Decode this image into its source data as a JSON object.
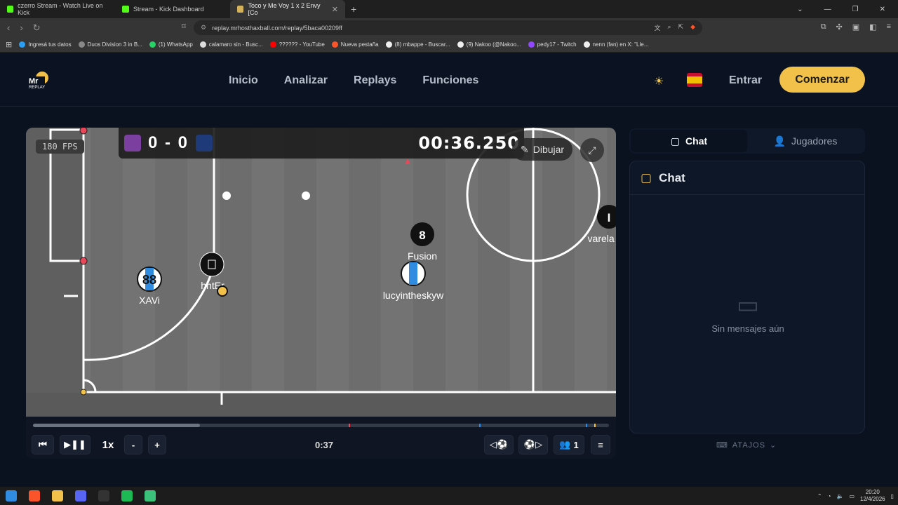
{
  "browser": {
    "tabs": [
      {
        "label": "czerro Stream - Watch Live on Kick",
        "color": "#53fc18"
      },
      {
        "label": "Stream - Kick Dashboard",
        "color": "#53fc18"
      },
      {
        "label": "Toco y Me Voy 1 x 2 Envy [Co",
        "color": "#d4b25a"
      }
    ],
    "url": "replay.mrhosthaxball.com/replay/5baca00209ff",
    "bookmarks": [
      "Ingresá tus datos",
      "Duos Division 3 in B...",
      "(1) WhatsApp",
      "calamaro sin - Busc...",
      "?????? - YouTube",
      "Nueva pestaña",
      "(8) mbappe - Buscar...",
      "(9) Nakoo (@Nakoo...",
      "pedy17 - Twitch",
      "nenn (fan) en X: \"Lle..."
    ]
  },
  "header": {
    "logo_text": "Mr REPLAY",
    "nav": [
      "Inicio",
      "Analizar",
      "Replays",
      "Funciones"
    ],
    "login": "Entrar",
    "cta": "Comenzar"
  },
  "replay": {
    "fps": "180 FPS",
    "score": "0 - 0",
    "clock": "00:36.250",
    "draw_label": "Dibujar",
    "players": [
      {
        "name": "XAVi",
        "number": "88",
        "team": "blue"
      },
      {
        "name": "hntEr",
        "number": "",
        "team": "black"
      },
      {
        "name": "Fusion",
        "number": "8",
        "team": "black"
      },
      {
        "name": "lucyintheskyw",
        "number": "",
        "team": "blue"
      },
      {
        "name": "varela in",
        "number": "I",
        "team": "black"
      }
    ],
    "controls": {
      "speed": "1x",
      "minus": "-",
      "plus": "+",
      "time": "0:37",
      "players_count": "1"
    },
    "progress": 0.29
  },
  "sidebar": {
    "tab_chat": "Chat",
    "tab_players": "Jugadores",
    "chat_title": "Chat",
    "empty": "Sin mensajes aún",
    "shortcuts": "ATAJOS"
  },
  "taskbar": {
    "time": "20:20",
    "date": "12/4/2026"
  }
}
